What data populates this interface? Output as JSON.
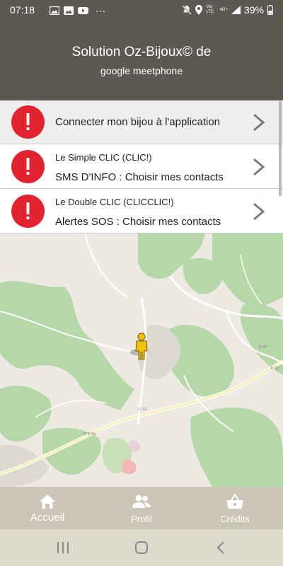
{
  "status_bar": {
    "time": "07:18",
    "more": "···",
    "network_label": "Vo) LTE",
    "network_type": "4G+",
    "battery": "39%"
  },
  "header": {
    "title": "Solution Oz-Bijoux© de",
    "subtitle": "google meetphone"
  },
  "list": {
    "items": [
      {
        "text": "Connecter mon bijou à l'application",
        "icon": "alert-icon"
      },
      {
        "line1": "Le Simple CLIC (CLIC!)",
        "line2": "SMS D'INFO : Choisir mes contacts",
        "icon": "alert-icon"
      },
      {
        "line1": "Le Double CLIC (CLICCLIC!)",
        "line2": "Alertes SOS : Choisir mes contacts",
        "icon": "alert-icon"
      }
    ]
  },
  "map": {
    "labels": [
      "D 37",
      "D 37",
      "D 47",
      "D 47",
      "D 47",
      "D 47",
      "D 47",
      "D 970a",
      "D 37"
    ]
  },
  "bottom_nav": {
    "items": [
      {
        "label": "Accueil",
        "icon": "home-icon"
      },
      {
        "label": "Profil",
        "icon": "people-icon"
      },
      {
        "label": "Crédits",
        "icon": "basket-icon"
      }
    ]
  },
  "colors": {
    "header_bg": "#5e5853",
    "alert_red": "#e0232e",
    "nav_bg": "#cac5b5"
  }
}
